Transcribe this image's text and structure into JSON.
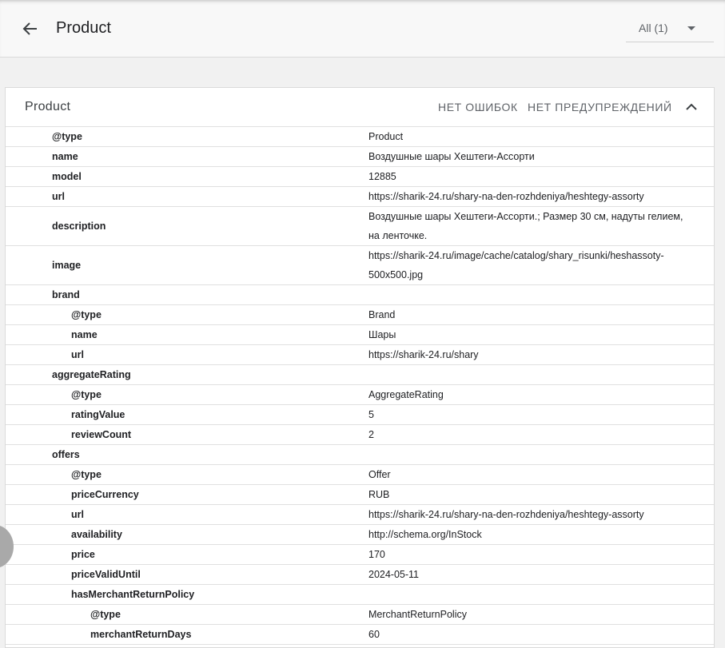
{
  "header": {
    "title": "Product",
    "filter": {
      "selected": "All (1)"
    }
  },
  "card": {
    "title": "Product",
    "errors_label": "НЕТ ОШИБОК",
    "warnings_label": "НЕТ ПРЕДУПРЕЖДЕНИЙ"
  },
  "rows": [
    {
      "key": "@type",
      "value": "Product",
      "level": 0
    },
    {
      "key": "name",
      "value": "Воздушные шары Хештеги-Ассорти",
      "level": 0
    },
    {
      "key": "model",
      "value": "12885",
      "level": 0
    },
    {
      "key": "url",
      "value": "https://sharik-24.ru/shary-na-den-rozhdeniya/heshtegy-assorty",
      "level": 0
    },
    {
      "key": "description",
      "value": "Воздушные шары Хештеги-Ассорти.; Размер 30 см, надуты гелием, на ленточке.",
      "level": 0,
      "tall": true
    },
    {
      "key": "image",
      "value": "https://sharik-24.ru/image/cache/catalog/shary_risunki/heshassoty-500x500.jpg",
      "level": 0,
      "tall": true
    },
    {
      "key": "brand",
      "value": "",
      "level": 0
    },
    {
      "key": "@type",
      "value": "Brand",
      "level": 1
    },
    {
      "key": "name",
      "value": "Шары",
      "level": 1
    },
    {
      "key": "url",
      "value": "https://sharik-24.ru/shary",
      "level": 1
    },
    {
      "key": "aggregateRating",
      "value": "",
      "level": 0
    },
    {
      "key": "@type",
      "value": "AggregateRating",
      "level": 1
    },
    {
      "key": "ratingValue",
      "value": "5",
      "level": 1
    },
    {
      "key": "reviewCount",
      "value": "2",
      "level": 1
    },
    {
      "key": "offers",
      "value": "",
      "level": 0
    },
    {
      "key": "@type",
      "value": "Offer",
      "level": 1
    },
    {
      "key": "priceCurrency",
      "value": "RUB",
      "level": 1
    },
    {
      "key": "url",
      "value": "https://sharik-24.ru/shary-na-den-rozhdeniya/heshtegy-assorty",
      "level": 1
    },
    {
      "key": "availability",
      "value": "http://schema.org/InStock",
      "level": 1
    },
    {
      "key": "price",
      "value": "170",
      "level": 1
    },
    {
      "key": "priceValidUntil",
      "value": "2024-05-11",
      "level": 1
    },
    {
      "key": "hasMerchantReturnPolicy",
      "value": "",
      "level": 1
    },
    {
      "key": "@type",
      "value": "MerchantReturnPolicy",
      "level": 2
    },
    {
      "key": "merchantReturnDays",
      "value": "60",
      "level": 2
    }
  ]
}
